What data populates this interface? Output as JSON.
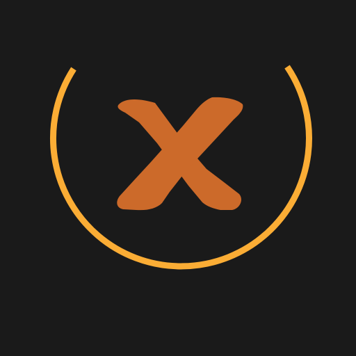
{
  "app_icon": {
    "icons": [
      "power-arc-icon",
      "x-mark-icon"
    ],
    "colors": {
      "background": "#1a1a1a",
      "ring": "#fbad35",
      "x_mark": "#cc6a2a"
    }
  }
}
